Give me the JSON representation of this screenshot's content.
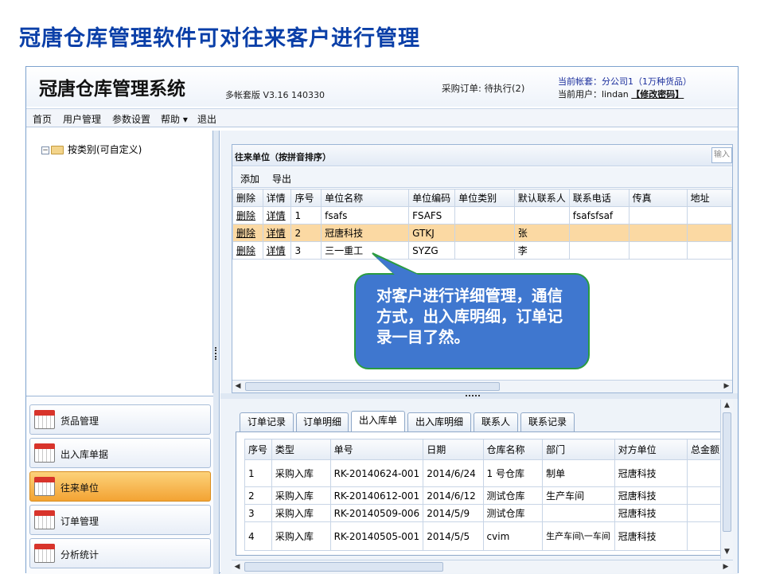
{
  "slide": {
    "title": "冠唐仓库管理软件可对往来客户进行管理"
  },
  "header": {
    "app_title": "冠唐仓库管理系统",
    "version": "多帐套版 V3.16 140330",
    "order_status": "采购订单: 待执行(2)",
    "account_label": "当前帐套：分公司1（1万种货品）",
    "user_label": "当前用户：lindan",
    "change_password": "【修改密码】"
  },
  "menu": [
    "首页",
    "用户管理",
    "参数设置",
    "帮助 ▾",
    "退出"
  ],
  "tree": {
    "root_label": "按类别(可自定义)"
  },
  "nav": {
    "items": [
      {
        "label": "货品管理",
        "active": false
      },
      {
        "label": "出入库单据",
        "active": false
      },
      {
        "label": "往来单位",
        "active": true
      },
      {
        "label": "订单管理",
        "active": false
      },
      {
        "label": "分析统计",
        "active": false
      }
    ]
  },
  "grid": {
    "title": "往来单位（按拼音排序）",
    "search_placeholder": "输入",
    "toolbar": {
      "add": "添加",
      "export": "导出"
    },
    "columns": [
      "删除",
      "详情",
      "序号",
      "单位名称",
      "单位编码",
      "单位类别",
      "默认联系人",
      "联系电话",
      "传真",
      "地址"
    ],
    "rows": [
      {
        "delete": "删除",
        "detail": "详情",
        "no": "1",
        "name": "fsafs",
        "code": "FSAFS",
        "category": "",
        "contact": "",
        "phone": "fsafsfsaf",
        "fax": "",
        "address": "",
        "selected": false
      },
      {
        "delete": "删除",
        "detail": "详情",
        "no": "2",
        "name": "冠唐科技",
        "code": "GTKJ",
        "category": "",
        "contact": "张",
        "phone": "",
        "fax": "",
        "address": "",
        "selected": true
      },
      {
        "delete": "删除",
        "detail": "详情",
        "no": "3",
        "name": "三一重工",
        "code": "SYZG",
        "category": "",
        "contact": "李",
        "phone": "",
        "fax": "",
        "address": "",
        "selected": false
      }
    ]
  },
  "callout": {
    "text": "对客户进行详细管理，通信方式，出入库明细，订单记录一目了然。"
  },
  "detail_tabs": {
    "tabs": [
      {
        "label": "订单记录",
        "active": false
      },
      {
        "label": "订单明细",
        "active": false
      },
      {
        "label": "出入库单",
        "active": true
      },
      {
        "label": "出入库明细",
        "active": false
      },
      {
        "label": "联系人",
        "active": false
      },
      {
        "label": "联系记录",
        "active": false
      }
    ],
    "columns": [
      "序号",
      "类型",
      "单号",
      "日期",
      "仓库名称",
      "部门",
      "对方单位",
      "总金额"
    ],
    "rows": [
      {
        "no": "1",
        "type": "采购入库",
        "number": "RK-20140624-001",
        "date": "2014/6/24",
        "warehouse": "1 号仓库",
        "dept": "制单",
        "party": "冠唐科技",
        "amount": ""
      },
      {
        "no": "2",
        "type": "采购入库",
        "number": "RK-20140612-001",
        "date": "2014/6/12",
        "warehouse": "测试仓库",
        "dept": "生产车间",
        "party": "冠唐科技",
        "amount": ""
      },
      {
        "no": "3",
        "type": "采购入库",
        "number": "RK-20140509-006",
        "date": "2014/5/9",
        "warehouse": "测试仓库",
        "dept": "",
        "party": "冠唐科技",
        "amount": ""
      },
      {
        "no": "4",
        "type": "采购入库",
        "number": "RK-20140505-001",
        "date": "2014/5/5",
        "warehouse": "cvim",
        "dept": "生产车间\\一车间",
        "party": "冠唐科技",
        "amount": ""
      }
    ]
  },
  "colors": {
    "title_blue": "#0a3fa8",
    "selected_row": "#fbd9a3",
    "active_nav": "#f3a333",
    "callout_fill": "#3f77cf",
    "callout_border": "#2a9c40"
  },
  "icons": {
    "nav_icon": "calendar-icon",
    "tree_icon": "folder-icon"
  }
}
